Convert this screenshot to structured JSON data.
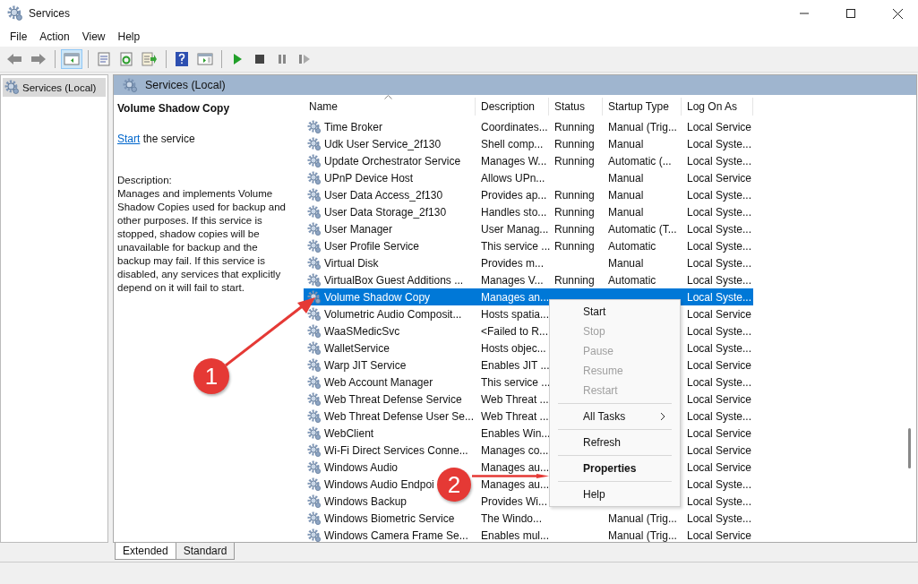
{
  "window": {
    "title": "Services"
  },
  "menu_bar": [
    "File",
    "Action",
    "View",
    "Help"
  ],
  "toolbar": [
    {
      "kind": "back",
      "selected": false
    },
    {
      "kind": "forward",
      "selected": false
    },
    {
      "kind": "separator"
    },
    {
      "kind": "tree",
      "selected": true
    },
    {
      "kind": "separator"
    },
    {
      "kind": "properties",
      "selected": false
    },
    {
      "kind": "refresh",
      "selected": false
    },
    {
      "kind": "export",
      "selected": false
    },
    {
      "kind": "separator"
    },
    {
      "kind": "help",
      "selected": false
    },
    {
      "kind": "pane",
      "selected": false
    },
    {
      "kind": "separator"
    },
    {
      "kind": "start",
      "selected": false
    },
    {
      "kind": "stop",
      "selected": false
    },
    {
      "kind": "pause",
      "selected": false
    },
    {
      "kind": "resume",
      "selected": false
    }
  ],
  "tree": [
    {
      "label": "Services (Local)",
      "selected": true
    }
  ],
  "pane_header": "Services (Local)",
  "details": {
    "title": "Volume Shadow Copy",
    "link": "Start",
    "link_rest": " the service",
    "description_label": "Description:",
    "description": "Manages and implements Volume Shadow Copies used for backup and other purposes. If this service is stopped, shadow copies will be unavailable for backup and the backup may fail. If this service is disabled, any services that explicitly depend on it will fail to start."
  },
  "table": {
    "columns": [
      "Name",
      "Description",
      "Status",
      "Startup Type",
      "Log On As"
    ],
    "rows": [
      {
        "name": "Time Broker",
        "description": "Coordinates...",
        "status": "Running",
        "startup": "Manual (Trig...",
        "logon": "Local Service",
        "selected": false
      },
      {
        "name": "Udk User Service_2f130",
        "description": "Shell comp...",
        "status": "Running",
        "startup": "Manual",
        "logon": "Local Syste...",
        "selected": false
      },
      {
        "name": "Update Orchestrator Service",
        "description": "Manages W...",
        "status": "Running",
        "startup": "Automatic (...",
        "logon": "Local Syste...",
        "selected": false
      },
      {
        "name": "UPnP Device Host",
        "description": "Allows UPn...",
        "startup": "Manual",
        "logon": "Local Service",
        "selected": false
      },
      {
        "name": "User Data Access_2f130",
        "description": "Provides ap...",
        "status": "Running",
        "startup": "Manual",
        "logon": "Local Syste...",
        "selected": false
      },
      {
        "name": "User Data Storage_2f130",
        "description": "Handles sto...",
        "status": "Running",
        "startup": "Manual",
        "logon": "Local Syste...",
        "selected": false
      },
      {
        "name": "User Manager",
        "description": "User Manag...",
        "status": "Running",
        "startup": "Automatic (T...",
        "logon": "Local Syste...",
        "selected": false
      },
      {
        "name": "User Profile Service",
        "description": "This service ...",
        "status": "Running",
        "startup": "Automatic",
        "logon": "Local Syste...",
        "selected": false
      },
      {
        "name": "Virtual Disk",
        "description": "Provides m...",
        "startup": "Manual",
        "logon": "Local Syste...",
        "selected": false
      },
      {
        "name": "VirtualBox Guest Additions ...",
        "description": "Manages V...",
        "status": "Running",
        "startup": "Automatic",
        "logon": "Local Syste...",
        "selected": false
      },
      {
        "name": "Volume Shadow Copy",
        "description": "Manages an...",
        "logon": "Local Syste...",
        "selected": true
      },
      {
        "name": "Volumetric Audio Composit...",
        "description": "Hosts spatia...",
        "logon": "Local Service",
        "selected": false
      },
      {
        "name": "WaaSMedicSvc",
        "description": "<Failed to R...",
        "logon": "Local Syste...",
        "selected": false
      },
      {
        "name": "WalletService",
        "description": "Hosts objec...",
        "logon": "Local Syste...",
        "selected": false
      },
      {
        "name": "Warp JIT Service",
        "description": "Enables JIT ...",
        "logon": "Local Service",
        "selected": false
      },
      {
        "name": "Web Account Manager",
        "description": "This service ...",
        "logon": "Local Syste...",
        "selected": false
      },
      {
        "name": "Web Threat Defense Service",
        "description": "Web Threat ...",
        "logon": "Local Service",
        "selected": false
      },
      {
        "name": "Web Threat Defense User Se...",
        "description": "Web Threat ...",
        "logon": "Local Syste...",
        "selected": false
      },
      {
        "name": "WebClient",
        "description": "Enables Win...",
        "logon": "Local Service",
        "selected": false
      },
      {
        "name": "Wi-Fi Direct Services Conne...",
        "description": "Manages co...",
        "logon": "Local Service",
        "selected": false
      },
      {
        "name": "Windows Audio",
        "description": "Manages au...",
        "logon": "Local Service",
        "selected": false
      },
      {
        "name": "Windows Audio Endpoi",
        "description": "Manages au...",
        "logon": "Local Syste...",
        "selected": false
      },
      {
        "name": "Windows Backup",
        "description": "Provides Wi...",
        "logon": "Local Syste...",
        "selected": false
      },
      {
        "name": "Windows Biometric Service",
        "description": "The Windo...",
        "startup": "Manual (Trig...",
        "logon": "Local Syste...",
        "selected": false
      },
      {
        "name": "Windows Camera Frame Se...",
        "description": "Enables mul...",
        "startup": "Manual (Trig...",
        "logon": "Local Service",
        "selected": false
      }
    ]
  },
  "context_menu": [
    {
      "kind": "item",
      "label": "Start",
      "disabled": false,
      "default": false,
      "submenu": false
    },
    {
      "kind": "item",
      "label": "Stop",
      "disabled": true,
      "default": false,
      "submenu": false
    },
    {
      "kind": "item",
      "label": "Pause",
      "disabled": true,
      "default": false,
      "submenu": false
    },
    {
      "kind": "item",
      "label": "Resume",
      "disabled": true,
      "default": false,
      "submenu": false
    },
    {
      "kind": "item",
      "label": "Restart",
      "disabled": true,
      "default": false,
      "submenu": false
    },
    {
      "kind": "separator"
    },
    {
      "kind": "item",
      "label": "All Tasks",
      "disabled": false,
      "default": false,
      "submenu": true
    },
    {
      "kind": "separator"
    },
    {
      "kind": "item",
      "label": "Refresh",
      "disabled": false,
      "default": false,
      "submenu": false
    },
    {
      "kind": "separator"
    },
    {
      "kind": "item",
      "label": "Properties",
      "disabled": false,
      "default": true,
      "submenu": false
    },
    {
      "kind": "separator"
    },
    {
      "kind": "item",
      "label": "Help",
      "disabled": false,
      "default": false,
      "submenu": false
    }
  ],
  "view_tabs": [
    {
      "label": "Extended",
      "selected": true
    },
    {
      "label": "Standard",
      "selected": false
    }
  ],
  "annotations": [
    {
      "number": "1"
    },
    {
      "number": "2"
    }
  ]
}
